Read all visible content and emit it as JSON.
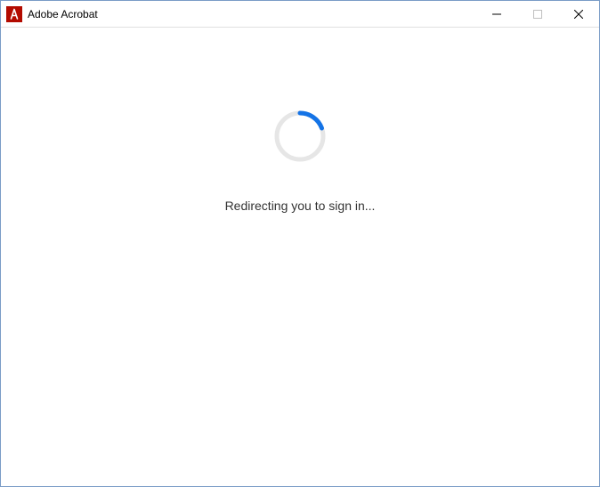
{
  "window": {
    "title": "Adobe Acrobat"
  },
  "content": {
    "status_text": "Redirecting you to sign in..."
  }
}
